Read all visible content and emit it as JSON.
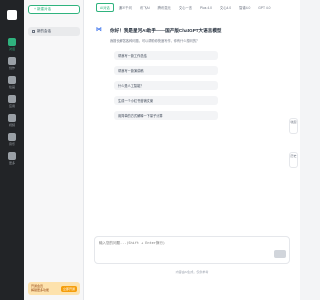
{
  "rail": {
    "items": [
      {
        "label": "对话",
        "icon": "chat-icon",
        "active": true
      },
      {
        "label": "创作",
        "icon": "pen-icon"
      },
      {
        "label": "绘画",
        "icon": "paint-icon"
      },
      {
        "label": "应用",
        "icon": "apps-icon"
      },
      {
        "label": "视频",
        "icon": "video-icon"
      },
      {
        "label": "音乐",
        "icon": "music-icon"
      },
      {
        "label": "更多",
        "icon": "more-icon"
      }
    ]
  },
  "sidebar": {
    "new_chat": "+ 新建对话",
    "chat_title": "新的会话",
    "promo_text": "开通会员\n解锁更多功能",
    "promo_btn": "立即开通"
  },
  "tabs": [
    "AI对话",
    "通义千问",
    "讯飞AI",
    "腾讯混元",
    "文心一言",
    "Plus 4.0",
    "文心4.0",
    "智谱4.0",
    "GPT 4.0"
  ],
  "greeting": "你好！我是星河AI助手——国产版ChatGPT大语言模型",
  "subtitle": "我擅长解答各种问题，可以帮助你快速写作，你有什么想问的？",
  "suggestions": [
    "帮我写一篇工作总结",
    "帮我写一篇演讲稿",
    "什么是人工智能？",
    "生成一个小红书营销文案",
    "用简单的方式解释一下量子计算"
  ],
  "floating": [
    "收起",
    "历史"
  ],
  "input": {
    "placeholder": "输入您的问题...(Shift + Enter换行)"
  },
  "footer": "内容由AI生成，仅供参考"
}
